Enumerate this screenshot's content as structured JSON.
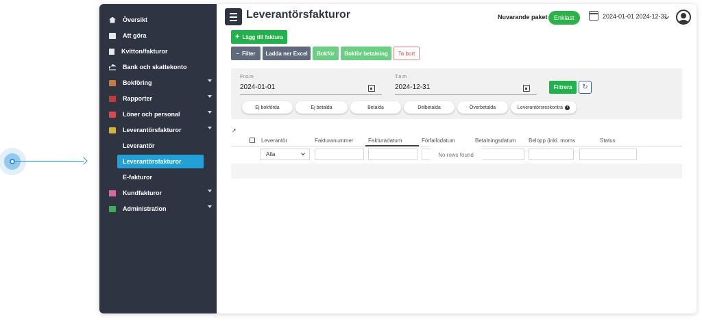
{
  "sidebar": {
    "items": [
      {
        "label": "Översikt",
        "icon": "home-icon"
      },
      {
        "label": "Att göra",
        "icon": "list-icon"
      },
      {
        "label": "Kvitton/fakturor",
        "icon": "receipt-icon"
      },
      {
        "label": "Bank och skattekonto",
        "icon": "bank-icon"
      },
      {
        "label": "Bokföring",
        "icon": "book-icon"
      },
      {
        "label": "Rapporter",
        "icon": "report-icon"
      },
      {
        "label": "Löner och personal",
        "icon": "salary-icon"
      },
      {
        "label": "Leverantörsfakturor",
        "icon": "supplier-icon"
      },
      {
        "label": "Kundfakturor",
        "icon": "customer-icon"
      },
      {
        "label": "Administration",
        "icon": "admin-icon"
      }
    ],
    "subitems": [
      "Leverantör",
      "Leverantörsfakturor",
      "E-fakturor"
    ],
    "active_subitem": "Leverantörsfakturor"
  },
  "header": {
    "title": "Leverantörsfakturor",
    "package_label": "Nuvarande paket",
    "package_badge": "Enklast",
    "date_range": "2024-01-01 2024-12-31"
  },
  "toolbar": {
    "add_label": "Lägg till faktura",
    "filter_label": "Filter",
    "excel_label": "Ladda ner Excel",
    "bokfor_label": "Bokför",
    "bokfor_betalning_label": "Bokför betalning",
    "tabort_label": "Ta bort"
  },
  "filters": {
    "from_label": "Fr.o.m",
    "from_value": "2024-01-01",
    "to_label": "T.o.m",
    "to_value": "2024-12-31",
    "filtrera_label": "Filtrera",
    "chips": [
      "Ej bokförda",
      "Ej betalda",
      "Betalda",
      "Delbetalda",
      "Överbetalda",
      "Leverantörsreskontra"
    ]
  },
  "grid": {
    "columns": [
      "Leverantör",
      "Fakturanummer",
      "Fakturadatum",
      "Förfallodatum",
      "Betalningsdatum",
      "Belopp (inkl. moms)",
      "Status"
    ],
    "supplier_filter_value": "Alla",
    "empty_text": "No rows found"
  },
  "colors": {
    "sidebar_bg": "#2f3443",
    "active_blue": "#24a0d8",
    "green": "#22b24b",
    "gray_button": "#5f6b7b",
    "danger": "#d94a4a"
  }
}
